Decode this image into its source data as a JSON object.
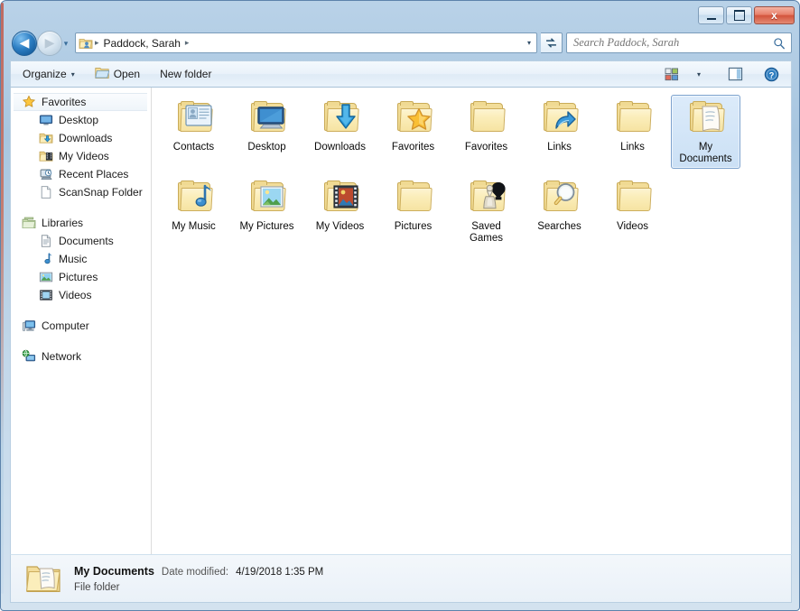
{
  "window": {
    "controls": {
      "minimize_label": "Minimize",
      "maximize_label": "Maximize",
      "close_label": "x"
    },
    "frame_color": "#5c83ab",
    "accent_color": "#c0584a"
  },
  "navbar": {
    "back_label": "◀",
    "forward_label": "▶",
    "history_label": "▾",
    "breadcrumb": {
      "icon": "user-folder-icon",
      "items": [
        "Paddock, Sarah"
      ],
      "separator": "▸",
      "trailing_separator": "▸",
      "dropdown_label": "▾"
    },
    "refresh_label": "↻",
    "search": {
      "placeholder": "Search Paddock, Sarah",
      "value": "",
      "icon": "search-icon"
    }
  },
  "toolbar": {
    "organize_label": "Organize",
    "organize_caret": "▾",
    "open_label": "Open",
    "new_folder_label": "New folder",
    "view_caret": "▾",
    "view_icon": "view-layout-icon",
    "preview_pane_icon": "preview-pane-icon",
    "help_icon": "help-icon",
    "help_glyph": "?"
  },
  "sidebar": {
    "groups": [
      {
        "header": {
          "label": "Favorites",
          "icon": "star-icon",
          "selected": true
        },
        "items": [
          {
            "label": "Desktop",
            "icon": "desktop-icon"
          },
          {
            "label": "Downloads",
            "icon": "downloads-folder-icon"
          },
          {
            "label": "My Videos",
            "icon": "videos-folder-icon"
          },
          {
            "label": "Recent Places",
            "icon": "recent-places-icon"
          },
          {
            "label": "ScanSnap Folder",
            "icon": "document-icon"
          }
        ]
      },
      {
        "header": {
          "label": "Libraries",
          "icon": "libraries-icon",
          "selected": false
        },
        "items": [
          {
            "label": "Documents",
            "icon": "documents-library-icon"
          },
          {
            "label": "Music",
            "icon": "music-note-icon"
          },
          {
            "label": "Pictures",
            "icon": "pictures-library-icon"
          },
          {
            "label": "Videos",
            "icon": "videos-library-icon"
          }
        ]
      },
      {
        "header": {
          "label": "Computer",
          "icon": "computer-icon",
          "selected": false
        },
        "items": []
      },
      {
        "header": {
          "label": "Network",
          "icon": "network-icon",
          "selected": false
        },
        "items": []
      }
    ]
  },
  "content": {
    "items": [
      {
        "label": "Contacts",
        "icon": "contacts-folder-icon",
        "selected": false
      },
      {
        "label": "Desktop",
        "icon": "desktop-folder-icon",
        "selected": false
      },
      {
        "label": "Downloads",
        "icon": "downloads-folder-icon",
        "selected": false
      },
      {
        "label": "Favorites",
        "icon": "favorites-folder-icon",
        "selected": false
      },
      {
        "label": "Favorites",
        "icon": "plain-folder-icon",
        "selected": false
      },
      {
        "label": "Links",
        "icon": "links-folder-icon",
        "selected": false
      },
      {
        "label": "Links",
        "icon": "plain-folder-icon",
        "selected": false
      },
      {
        "label": "My Documents",
        "icon": "documents-folder-icon",
        "selected": true
      },
      {
        "label": "My Music",
        "icon": "music-folder-icon",
        "selected": false
      },
      {
        "label": "My Pictures",
        "icon": "pictures-folder-icon",
        "selected": false
      },
      {
        "label": "My Videos",
        "icon": "videos-folder-icon",
        "selected": false
      },
      {
        "label": "Pictures",
        "icon": "plain-folder-icon",
        "selected": false
      },
      {
        "label": "Saved Games",
        "icon": "saved-games-folder-icon",
        "selected": false
      },
      {
        "label": "Searches",
        "icon": "searches-folder-icon",
        "selected": false
      },
      {
        "label": "Videos",
        "icon": "plain-folder-icon",
        "selected": false
      }
    ]
  },
  "statusbar": {
    "icon": "documents-folder-icon",
    "name": "My Documents",
    "date_modified_label": "Date modified:",
    "date_modified_value": "4/19/2018 1:35 PM",
    "type": "File folder"
  }
}
